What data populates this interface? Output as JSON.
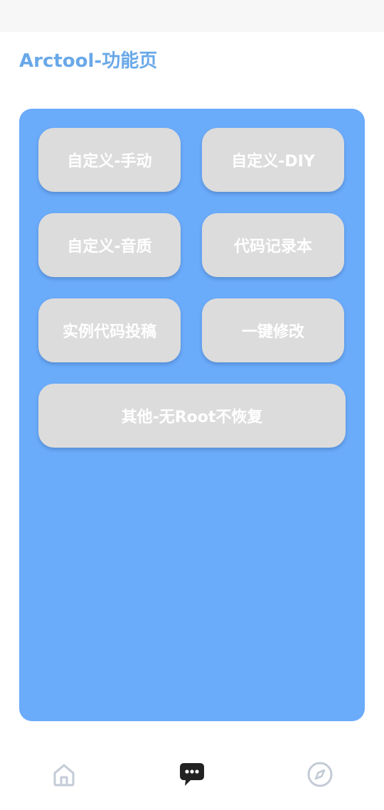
{
  "page": {
    "title": "Arctool-功能页"
  },
  "buttons": {
    "custom_manual": "自定义-手动",
    "custom_diy": "自定义-DIY",
    "custom_sound": "自定义-音质",
    "code_notebook": "代码记录本",
    "submit_example_code": "实例代码投稿",
    "one_click_modify": "一键修改",
    "other_no_root": "其他-无Root不恢复"
  },
  "bottom_nav": {
    "items": [
      {
        "icon": "home-icon",
        "active": false
      },
      {
        "icon": "chat-bubble-icon",
        "active": true
      },
      {
        "icon": "compass-icon",
        "active": false
      }
    ]
  },
  "colors": {
    "accent": "#69a8e8",
    "panel": "#6aabfa",
    "button": "#dcdcdc",
    "button_text": "#ffffff",
    "nav_inactive": "#c3cbd6",
    "nav_active": "#222222"
  }
}
